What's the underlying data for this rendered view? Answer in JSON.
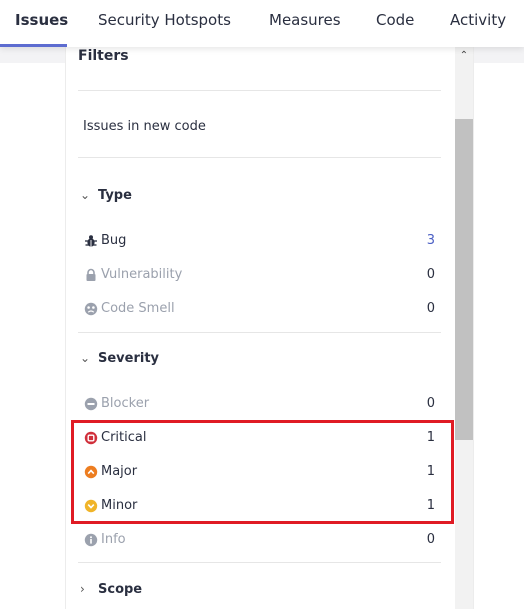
{
  "tabs": [
    {
      "label": "Issues",
      "active": true
    },
    {
      "label": "Security Hotspots",
      "active": false
    },
    {
      "label": "Measures",
      "active": false
    },
    {
      "label": "Code",
      "active": false
    },
    {
      "label": "Activity",
      "active": false
    }
  ],
  "filters": {
    "title": "Filters",
    "new_code_label": "Issues in new code",
    "type": {
      "label": "Type",
      "items": [
        {
          "label": "Bug",
          "count": "3",
          "icon": "bug-icon"
        },
        {
          "label": "Vulnerability",
          "count": "0",
          "icon": "lock-icon"
        },
        {
          "label": "Code Smell",
          "count": "0",
          "icon": "code-smell-icon"
        }
      ]
    },
    "severity": {
      "label": "Severity",
      "items": [
        {
          "label": "Blocker",
          "count": "0",
          "icon": "blocker-icon",
          "color": "#9ba1ad"
        },
        {
          "label": "Critical",
          "count": "1",
          "icon": "critical-icon",
          "color": "#d02f3a"
        },
        {
          "label": "Major",
          "count": "1",
          "icon": "major-icon",
          "color": "#ed7d20"
        },
        {
          "label": "Minor",
          "count": "1",
          "icon": "minor-icon",
          "color": "#f0b429"
        },
        {
          "label": "Info",
          "count": "0",
          "icon": "info-icon",
          "color": "#9ba1ad"
        }
      ]
    },
    "scope": {
      "label": "Scope"
    }
  },
  "colors": {
    "accent": "#5d6cd0",
    "highlight": "#e01b24",
    "link_count": "#4b5fc4"
  }
}
